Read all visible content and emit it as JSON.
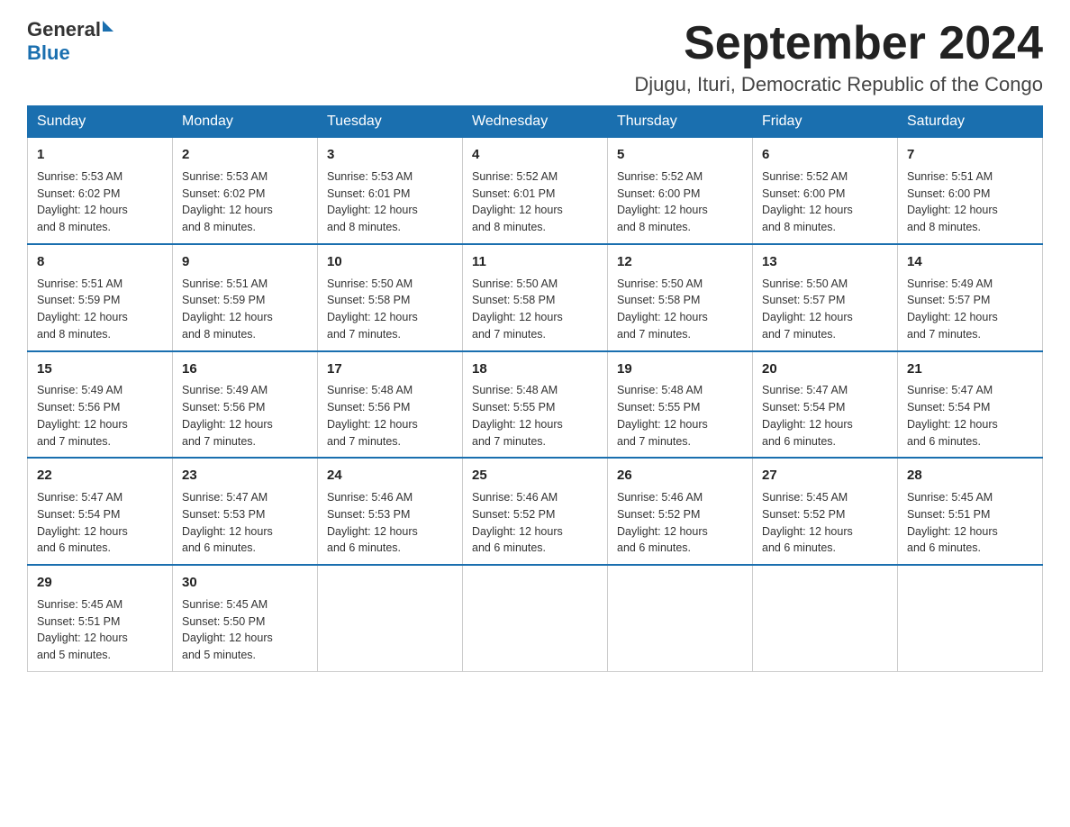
{
  "header": {
    "logo_general": "General",
    "logo_blue": "Blue",
    "month_title": "September 2024",
    "subtitle": "Djugu, Ituri, Democratic Republic of the Congo"
  },
  "days_of_week": [
    "Sunday",
    "Monday",
    "Tuesday",
    "Wednesday",
    "Thursday",
    "Friday",
    "Saturday"
  ],
  "weeks": [
    [
      {
        "day": "1",
        "sunrise": "5:53 AM",
        "sunset": "6:02 PM",
        "daylight": "12 hours and 8 minutes."
      },
      {
        "day": "2",
        "sunrise": "5:53 AM",
        "sunset": "6:02 PM",
        "daylight": "12 hours and 8 minutes."
      },
      {
        "day": "3",
        "sunrise": "5:53 AM",
        "sunset": "6:01 PM",
        "daylight": "12 hours and 8 minutes."
      },
      {
        "day": "4",
        "sunrise": "5:52 AM",
        "sunset": "6:01 PM",
        "daylight": "12 hours and 8 minutes."
      },
      {
        "day": "5",
        "sunrise": "5:52 AM",
        "sunset": "6:00 PM",
        "daylight": "12 hours and 8 minutes."
      },
      {
        "day": "6",
        "sunrise": "5:52 AM",
        "sunset": "6:00 PM",
        "daylight": "12 hours and 8 minutes."
      },
      {
        "day": "7",
        "sunrise": "5:51 AM",
        "sunset": "6:00 PM",
        "daylight": "12 hours and 8 minutes."
      }
    ],
    [
      {
        "day": "8",
        "sunrise": "5:51 AM",
        "sunset": "5:59 PM",
        "daylight": "12 hours and 8 minutes."
      },
      {
        "day": "9",
        "sunrise": "5:51 AM",
        "sunset": "5:59 PM",
        "daylight": "12 hours and 8 minutes."
      },
      {
        "day": "10",
        "sunrise": "5:50 AM",
        "sunset": "5:58 PM",
        "daylight": "12 hours and 7 minutes."
      },
      {
        "day": "11",
        "sunrise": "5:50 AM",
        "sunset": "5:58 PM",
        "daylight": "12 hours and 7 minutes."
      },
      {
        "day": "12",
        "sunrise": "5:50 AM",
        "sunset": "5:58 PM",
        "daylight": "12 hours and 7 minutes."
      },
      {
        "day": "13",
        "sunrise": "5:50 AM",
        "sunset": "5:57 PM",
        "daylight": "12 hours and 7 minutes."
      },
      {
        "day": "14",
        "sunrise": "5:49 AM",
        "sunset": "5:57 PM",
        "daylight": "12 hours and 7 minutes."
      }
    ],
    [
      {
        "day": "15",
        "sunrise": "5:49 AM",
        "sunset": "5:56 PM",
        "daylight": "12 hours and 7 minutes."
      },
      {
        "day": "16",
        "sunrise": "5:49 AM",
        "sunset": "5:56 PM",
        "daylight": "12 hours and 7 minutes."
      },
      {
        "day": "17",
        "sunrise": "5:48 AM",
        "sunset": "5:56 PM",
        "daylight": "12 hours and 7 minutes."
      },
      {
        "day": "18",
        "sunrise": "5:48 AM",
        "sunset": "5:55 PM",
        "daylight": "12 hours and 7 minutes."
      },
      {
        "day": "19",
        "sunrise": "5:48 AM",
        "sunset": "5:55 PM",
        "daylight": "12 hours and 7 minutes."
      },
      {
        "day": "20",
        "sunrise": "5:47 AM",
        "sunset": "5:54 PM",
        "daylight": "12 hours and 6 minutes."
      },
      {
        "day": "21",
        "sunrise": "5:47 AM",
        "sunset": "5:54 PM",
        "daylight": "12 hours and 6 minutes."
      }
    ],
    [
      {
        "day": "22",
        "sunrise": "5:47 AM",
        "sunset": "5:54 PM",
        "daylight": "12 hours and 6 minutes."
      },
      {
        "day": "23",
        "sunrise": "5:47 AM",
        "sunset": "5:53 PM",
        "daylight": "12 hours and 6 minutes."
      },
      {
        "day": "24",
        "sunrise": "5:46 AM",
        "sunset": "5:53 PM",
        "daylight": "12 hours and 6 minutes."
      },
      {
        "day": "25",
        "sunrise": "5:46 AM",
        "sunset": "5:52 PM",
        "daylight": "12 hours and 6 minutes."
      },
      {
        "day": "26",
        "sunrise": "5:46 AM",
        "sunset": "5:52 PM",
        "daylight": "12 hours and 6 minutes."
      },
      {
        "day": "27",
        "sunrise": "5:45 AM",
        "sunset": "5:52 PM",
        "daylight": "12 hours and 6 minutes."
      },
      {
        "day": "28",
        "sunrise": "5:45 AM",
        "sunset": "5:51 PM",
        "daylight": "12 hours and 6 minutes."
      }
    ],
    [
      {
        "day": "29",
        "sunrise": "5:45 AM",
        "sunset": "5:51 PM",
        "daylight": "12 hours and 5 minutes."
      },
      {
        "day": "30",
        "sunrise": "5:45 AM",
        "sunset": "5:50 PM",
        "daylight": "12 hours and 5 minutes."
      },
      null,
      null,
      null,
      null,
      null
    ]
  ],
  "labels": {
    "sunrise": "Sunrise:",
    "sunset": "Sunset:",
    "daylight": "Daylight:"
  }
}
